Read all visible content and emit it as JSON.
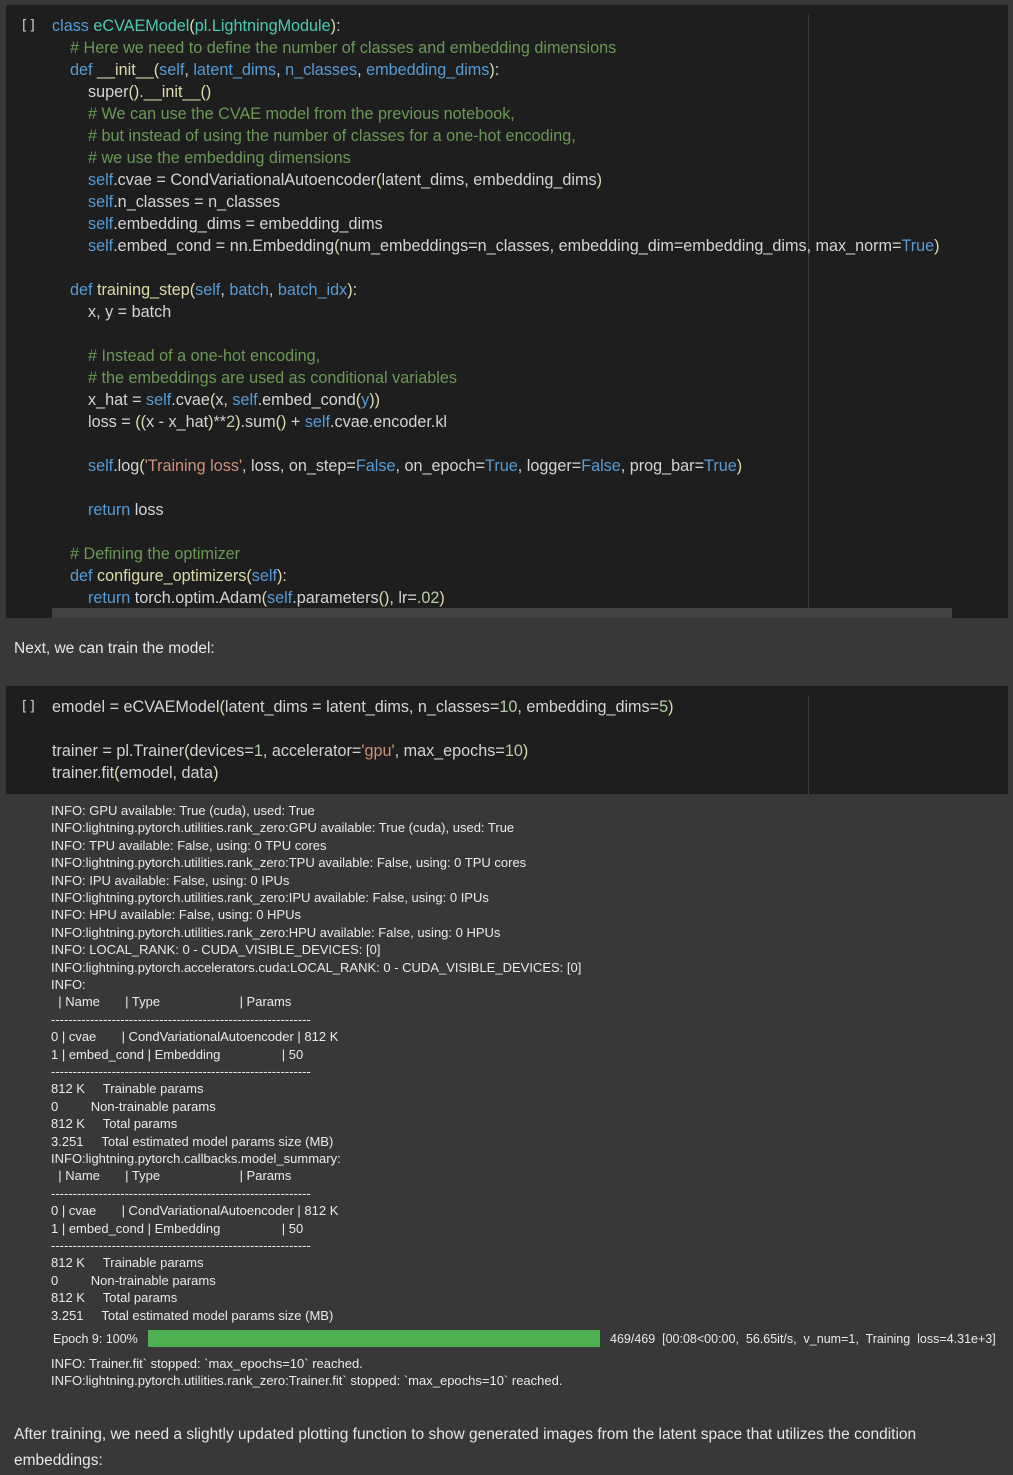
{
  "cell1": {
    "run_label": "[]",
    "lines": [
      [
        {
          "c": "k",
          "t": "class "
        },
        {
          "c": "t",
          "t": "eCVAEModel"
        },
        {
          "c": "p",
          "t": "("
        },
        {
          "c": "t",
          "t": "pl.LightningModule"
        },
        {
          "c": "p",
          "t": ")"
        },
        {
          "c": "",
          "t": ":"
        }
      ],
      [
        {
          "c": "",
          "t": "    "
        },
        {
          "c": "c",
          "t": "# Here we need to define the number of classes and embedding dimensions"
        }
      ],
      [
        {
          "c": "",
          "t": "    "
        },
        {
          "c": "k",
          "t": "def "
        },
        {
          "c": "p",
          "t": "__init__"
        },
        {
          "c": "p",
          "t": "("
        },
        {
          "c": "sf",
          "t": "self"
        },
        {
          "c": "",
          "t": ", "
        },
        {
          "c": "sf",
          "t": "latent_dims"
        },
        {
          "c": "",
          "t": ", "
        },
        {
          "c": "sf",
          "t": "n_classes"
        },
        {
          "c": "",
          "t": ", "
        },
        {
          "c": "sf",
          "t": "embedding_dims"
        },
        {
          "c": "p",
          "t": ")"
        },
        {
          "c": "",
          "t": ":"
        }
      ],
      [
        {
          "c": "",
          "t": "        super"
        },
        {
          "c": "p",
          "t": "()"
        },
        {
          "c": "",
          "t": "."
        },
        {
          "c": "p",
          "t": "__init__"
        },
        {
          "c": "p",
          "t": "()"
        }
      ],
      [
        {
          "c": "",
          "t": "        "
        },
        {
          "c": "c",
          "t": "# We can use the CVAE model from the previous notebook,"
        }
      ],
      [
        {
          "c": "",
          "t": "        "
        },
        {
          "c": "c",
          "t": "# but instead of using the number of classes for a one-hot encoding,"
        }
      ],
      [
        {
          "c": "",
          "t": "        "
        },
        {
          "c": "c",
          "t": "# we use the embedding dimensions"
        }
      ],
      [
        {
          "c": "",
          "t": "        "
        },
        {
          "c": "sf",
          "t": "self"
        },
        {
          "c": "",
          "t": ".cvae = CondVariationalAutoencoder"
        },
        {
          "c": "p",
          "t": "("
        },
        {
          "c": "",
          "t": "latent_dims, embedding_dims"
        },
        {
          "c": "p",
          "t": ")"
        }
      ],
      [
        {
          "c": "",
          "t": "        "
        },
        {
          "c": "sf",
          "t": "self"
        },
        {
          "c": "",
          "t": ".n_classes = n_classes"
        }
      ],
      [
        {
          "c": "",
          "t": "        "
        },
        {
          "c": "sf",
          "t": "self"
        },
        {
          "c": "",
          "t": ".embedding_dims = embedding_dims"
        }
      ],
      [
        {
          "c": "",
          "t": "        "
        },
        {
          "c": "sf",
          "t": "self"
        },
        {
          "c": "",
          "t": ".embed_cond = nn.Embedding"
        },
        {
          "c": "p",
          "t": "("
        },
        {
          "c": "",
          "t": "num_embeddings=n_classes, embedding_dim=embedding_dims, max_norm="
        },
        {
          "c": "k",
          "t": "True"
        },
        {
          "c": "p",
          "t": ")"
        }
      ],
      [
        {
          "c": "",
          "t": ""
        }
      ],
      [
        {
          "c": "",
          "t": "    "
        },
        {
          "c": "k",
          "t": "def "
        },
        {
          "c": "p",
          "t": "training_step"
        },
        {
          "c": "p",
          "t": "("
        },
        {
          "c": "sf",
          "t": "self"
        },
        {
          "c": "",
          "t": ", "
        },
        {
          "c": "sf",
          "t": "batch"
        },
        {
          "c": "",
          "t": ", "
        },
        {
          "c": "sf",
          "t": "batch_idx"
        },
        {
          "c": "p",
          "t": ")"
        },
        {
          "c": "",
          "t": ":"
        }
      ],
      [
        {
          "c": "",
          "t": "        x, y = batch"
        }
      ],
      [
        {
          "c": "",
          "t": ""
        }
      ],
      [
        {
          "c": "",
          "t": "        "
        },
        {
          "c": "c",
          "t": "# Instead of a one-hot encoding,"
        }
      ],
      [
        {
          "c": "",
          "t": "        "
        },
        {
          "c": "c",
          "t": "# the embeddings are used as conditional variables"
        }
      ],
      [
        {
          "c": "",
          "t": "        x_hat = "
        },
        {
          "c": "sf",
          "t": "self"
        },
        {
          "c": "",
          "t": ".cvae"
        },
        {
          "c": "p",
          "t": "("
        },
        {
          "c": "",
          "t": "x, "
        },
        {
          "c": "sf",
          "t": "self"
        },
        {
          "c": "",
          "t": ".embed_cond"
        },
        {
          "c": "p",
          "t": "("
        },
        {
          "c": "sf",
          "t": "y"
        },
        {
          "c": "p",
          "t": "))"
        }
      ],
      [
        {
          "c": "",
          "t": "        loss = "
        },
        {
          "c": "p",
          "t": "(("
        },
        {
          "c": "",
          "t": "x - x_hat"
        },
        {
          "c": "p",
          "t": ")"
        },
        {
          "c": "",
          "t": "**"
        },
        {
          "c": "n",
          "t": "2"
        },
        {
          "c": "p",
          "t": ")"
        },
        {
          "c": "",
          "t": ".sum"
        },
        {
          "c": "p",
          "t": "()"
        },
        {
          "c": "",
          "t": " + "
        },
        {
          "c": "sf",
          "t": "self"
        },
        {
          "c": "",
          "t": ".cvae.encoder.kl"
        }
      ],
      [
        {
          "c": "",
          "t": ""
        }
      ],
      [
        {
          "c": "",
          "t": "        "
        },
        {
          "c": "sf",
          "t": "self"
        },
        {
          "c": "",
          "t": ".log"
        },
        {
          "c": "p",
          "t": "("
        },
        {
          "c": "s",
          "t": "'Training loss'"
        },
        {
          "c": "",
          "t": ", loss, on_step="
        },
        {
          "c": "k",
          "t": "False"
        },
        {
          "c": "",
          "t": ", on_epoch="
        },
        {
          "c": "k",
          "t": "True"
        },
        {
          "c": "",
          "t": ", logger="
        },
        {
          "c": "k",
          "t": "False"
        },
        {
          "c": "",
          "t": ", prog_bar="
        },
        {
          "c": "k",
          "t": "True"
        },
        {
          "c": "p",
          "t": ")"
        }
      ],
      [
        {
          "c": "",
          "t": ""
        }
      ],
      [
        {
          "c": "",
          "t": "        "
        },
        {
          "c": "k",
          "t": "return"
        },
        {
          "c": "",
          "t": " loss"
        }
      ],
      [
        {
          "c": "",
          "t": ""
        }
      ],
      [
        {
          "c": "",
          "t": "    "
        },
        {
          "c": "c",
          "t": "# Defining the optimizer"
        }
      ],
      [
        {
          "c": "",
          "t": "    "
        },
        {
          "c": "k",
          "t": "def "
        },
        {
          "c": "p",
          "t": "configure_optimizers"
        },
        {
          "c": "p",
          "t": "("
        },
        {
          "c": "sf",
          "t": "self"
        },
        {
          "c": "p",
          "t": ")"
        },
        {
          "c": "",
          "t": ":"
        }
      ],
      [
        {
          "c": "",
          "t": "        "
        },
        {
          "c": "k",
          "t": "return"
        },
        {
          "c": "",
          "t": " torch.optim.Adam"
        },
        {
          "c": "p",
          "t": "("
        },
        {
          "c": "sf",
          "t": "self"
        },
        {
          "c": "",
          "t": ".parameters"
        },
        {
          "c": "p",
          "t": "()"
        },
        {
          "c": "",
          "t": ", lr="
        },
        {
          "c": "n",
          "t": ".02"
        },
        {
          "c": "p",
          "t": ")"
        }
      ]
    ]
  },
  "md1": "Next, we can train the model:",
  "cell2": {
    "run_label": "[]",
    "lines": [
      [
        {
          "c": "",
          "t": "emodel = eCVAEModel"
        },
        {
          "c": "p",
          "t": "("
        },
        {
          "c": "",
          "t": "latent_dims = latent_dims, n_classes="
        },
        {
          "c": "n",
          "t": "10"
        },
        {
          "c": "",
          "t": ", embedding_dims="
        },
        {
          "c": "n",
          "t": "5"
        },
        {
          "c": "p",
          "t": ")"
        }
      ],
      [
        {
          "c": "",
          "t": ""
        }
      ],
      [
        {
          "c": "",
          "t": "trainer = pl.Trainer"
        },
        {
          "c": "p",
          "t": "("
        },
        {
          "c": "",
          "t": "devices="
        },
        {
          "c": "n",
          "t": "1"
        },
        {
          "c": "",
          "t": ", accelerator="
        },
        {
          "c": "s",
          "t": "'gpu'"
        },
        {
          "c": "",
          "t": ", max_epochs="
        },
        {
          "c": "n",
          "t": "10"
        },
        {
          "c": "p",
          "t": ")"
        }
      ],
      [
        {
          "c": "",
          "t": "trainer.fit"
        },
        {
          "c": "p",
          "t": "("
        },
        {
          "c": "",
          "t": "emodel, data"
        },
        {
          "c": "p",
          "t": ")"
        }
      ]
    ]
  },
  "output": {
    "log_lines": [
      "INFO: GPU available: True (cuda), used: True",
      "INFO:lightning.pytorch.utilities.rank_zero:GPU available: True (cuda), used: True",
      "INFO: TPU available: False, using: 0 TPU cores",
      "INFO:lightning.pytorch.utilities.rank_zero:TPU available: False, using: 0 TPU cores",
      "INFO: IPU available: False, using: 0 IPUs",
      "INFO:lightning.pytorch.utilities.rank_zero:IPU available: False, using: 0 IPUs",
      "INFO: HPU available: False, using: 0 HPUs",
      "INFO:lightning.pytorch.utilities.rank_zero:HPU available: False, using: 0 HPUs",
      "INFO: LOCAL_RANK: 0 - CUDA_VISIBLE_DEVICES: [0]",
      "INFO:lightning.pytorch.accelerators.cuda:LOCAL_RANK: 0 - CUDA_VISIBLE_DEVICES: [0]",
      "INFO:",
      "  | Name       | Type                      | Params",
      "------------------------------------------------------------",
      "0 | cvae       | CondVariationalAutoencoder | 812 K",
      "1 | embed_cond | Embedding                 | 50",
      "------------------------------------------------------------",
      "812 K     Trainable params",
      "0         Non-trainable params",
      "812 K     Total params",
      "3.251     Total estimated model params size (MB)",
      "INFO:lightning.pytorch.callbacks.model_summary:",
      "  | Name       | Type                      | Params",
      "------------------------------------------------------------",
      "0 | cvae       | CondVariationalAutoencoder | 812 K",
      "1 | embed_cond | Embedding                 | 50",
      "------------------------------------------------------------",
      "812 K     Trainable params",
      "0         Non-trainable params",
      "812 K     Total params",
      "3.251     Total estimated model params size (MB)"
    ],
    "progress": {
      "label": "Epoch  9:  100%",
      "fraction": 1.0,
      "stats": "469/469  [00:08<00:00,  56.65it/s,  v_num=1,  Training  loss=4.31e+3]",
      "color": "#4caf50"
    },
    "tail_lines": [
      "INFO: Trainer.fit` stopped: `max_epochs=10` reached.",
      "INFO:lightning.pytorch.utilities.rank_zero:Trainer.fit` stopped: `max_epochs=10` reached."
    ]
  },
  "md2_line1": "After training, we need a slightly updated plotting function to show generated images from the latent space that utilizes the condition",
  "md2_line2": "embeddings:"
}
